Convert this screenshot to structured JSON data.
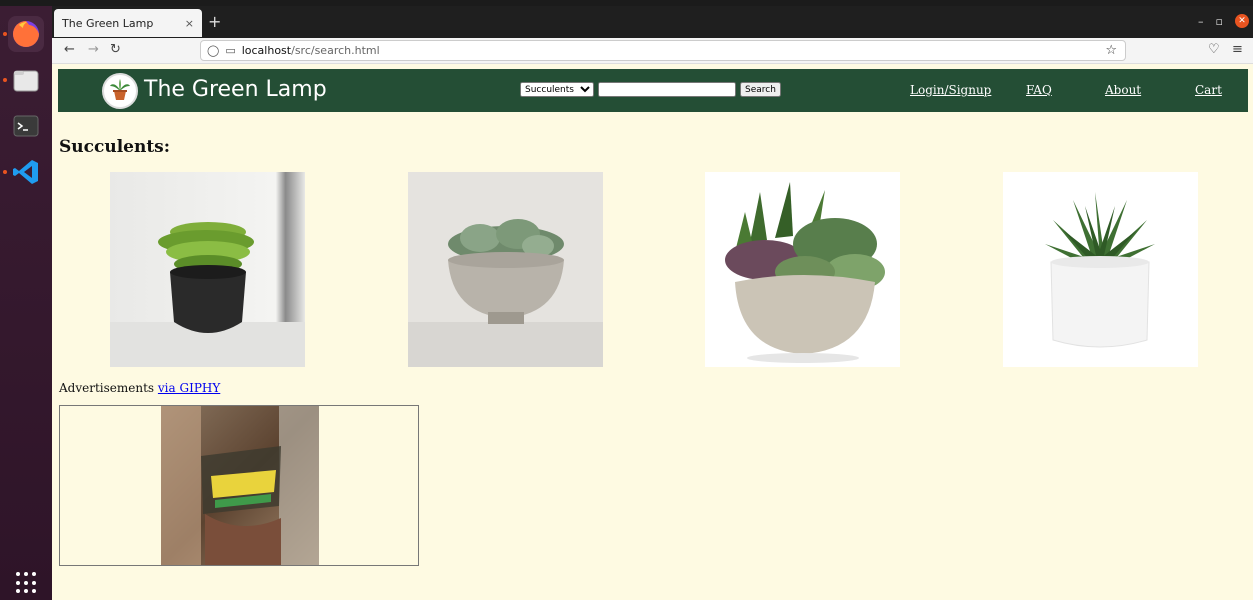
{
  "browser": {
    "tab_title": "The Green Lamp",
    "tab_close": "×",
    "new_tab": "+",
    "url_host": "localhost",
    "url_path": "/src/search.html",
    "win_min": "–",
    "win_max": "▫",
    "win_close": "✕"
  },
  "header": {
    "title": "The Green Lamp",
    "category_selected": "Succulents",
    "search_value": "",
    "search_button": "Search",
    "nav": {
      "login": "Login/Signup",
      "faq": "FAQ",
      "about": "About",
      "cart": "Cart"
    }
  },
  "main": {
    "heading": "Succulents:",
    "ads_label": "Advertisements",
    "ads_link": "via GIPHY"
  }
}
